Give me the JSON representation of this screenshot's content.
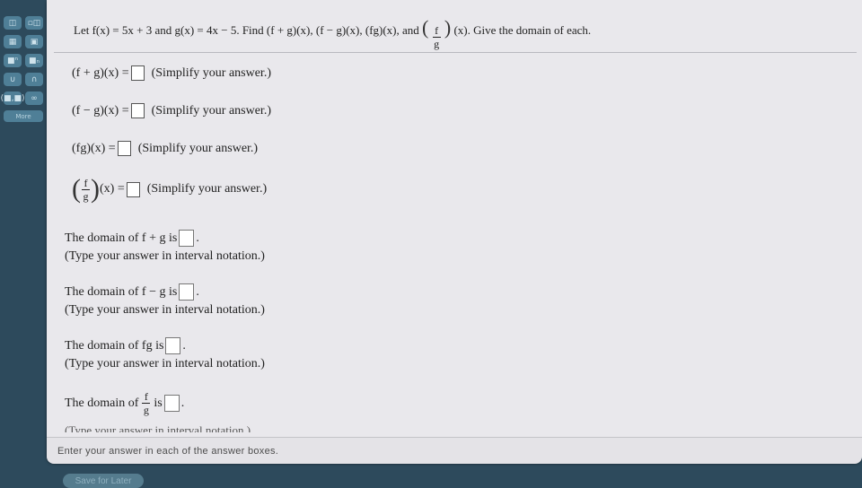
{
  "toolbar": {
    "buttons": [
      {
        "name": "fraction-button",
        "glyph": "◫"
      },
      {
        "name": "mixed-fraction-button",
        "glyph": "▫◫"
      },
      {
        "name": "matrix-button",
        "glyph": "▦"
      },
      {
        "name": "matrix2-button",
        "glyph": "▣"
      },
      {
        "name": "exponent-button",
        "glyph": "■ⁿ"
      },
      {
        "name": "subscript-button",
        "glyph": "■ₙ"
      },
      {
        "name": "union-button",
        "glyph": "∪"
      },
      {
        "name": "intersection-button",
        "glyph": "∩"
      },
      {
        "name": "interval-button",
        "glyph": "(■,■)"
      },
      {
        "name": "infinity-button",
        "glyph": "∞"
      }
    ],
    "more_label": "More"
  },
  "question": {
    "text": "Let f(x) = 5x + 3 and g(x) = 4x − 5. Find (f + g)(x), (f − g)(x), (fg)(x), and",
    "frac_num": "f",
    "frac_den": "g",
    "text_after": "(x). Give the domain of each."
  },
  "answers": {
    "sum_label": "(f + g)(x) =",
    "diff_label": "(f − g)(x) =",
    "prod_label": "(fg)(x) =",
    "quot_suffix": "(x) =",
    "hint": "(Simplify your answer.)"
  },
  "domains": {
    "sum_label": "The domain of f + g is",
    "diff_label": "The domain of f − g is",
    "prod_label": "The domain of fg is",
    "quot_prefix": "The domain of",
    "quot_suffix": "is",
    "period": ".",
    "hint": "(Type your answer in interval notation.)"
  },
  "footer": {
    "instruction": "Enter your answer in each of the answer boxes.",
    "save_label": "Save for Later"
  }
}
